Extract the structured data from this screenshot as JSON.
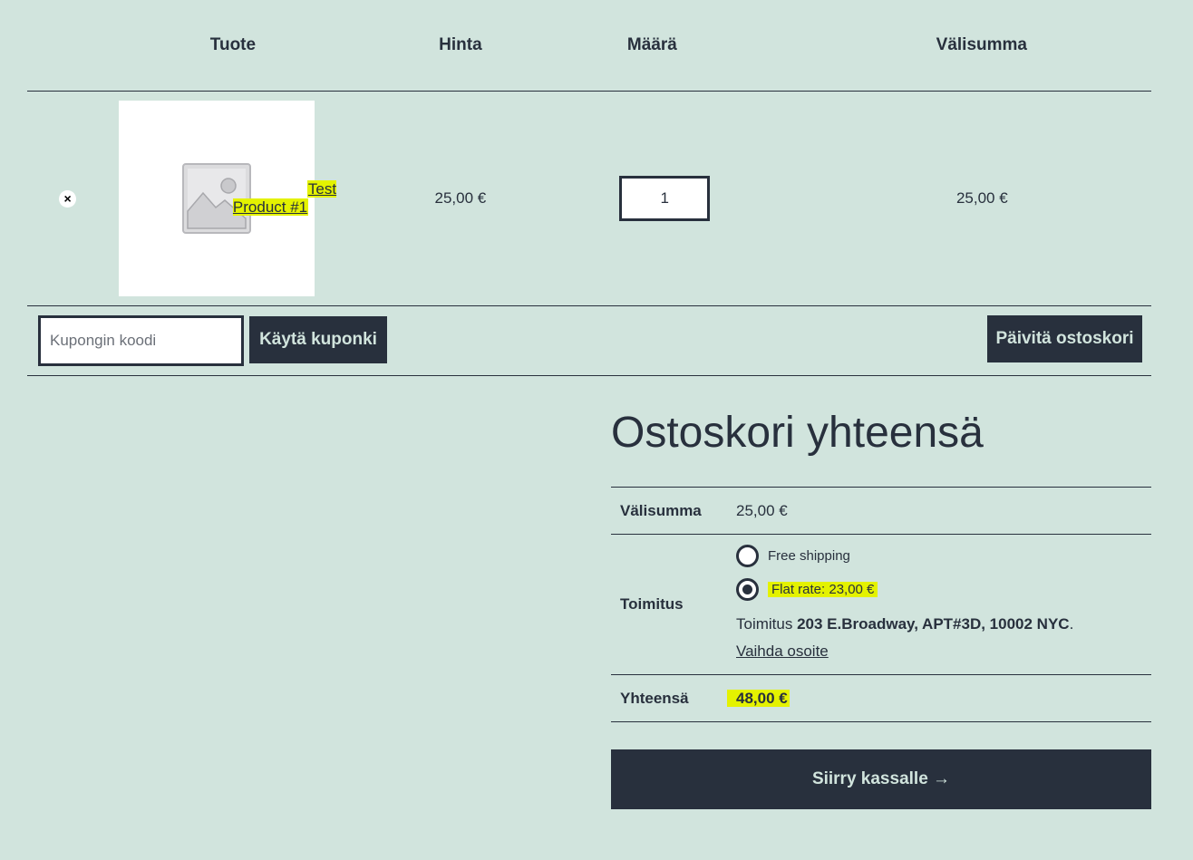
{
  "cart": {
    "headers": {
      "product": "Tuote",
      "price": "Hinta",
      "quantity": "Määrä",
      "subtotal": "Välisumma"
    },
    "items": [
      {
        "remove_symbol": "×",
        "thumbnail_icon": "image-placeholder-icon",
        "name": "Test Product #1",
        "price": "25,00 €",
        "quantity": "1",
        "subtotal": "25,00 €"
      }
    ],
    "coupon": {
      "placeholder": "Kupongin koodi",
      "value": "",
      "apply_label": "Käytä kuponki"
    },
    "update_label": "Päivitä ostoskori"
  },
  "totals": {
    "title": "Ostoskori yhteensä",
    "subtotal_label": "Välisumma",
    "subtotal_value": "25,00 €",
    "shipping_label": "Toimitus",
    "shipping_options": [
      {
        "label": "Free shipping",
        "selected": false
      },
      {
        "label": "Flat rate: 23,00 €",
        "selected": true
      }
    ],
    "destination_prefix": "Toimitus",
    "destination_address": "203 E.Broadway, APT#3D, 10002 NYC",
    "destination_suffix": ".",
    "change_address_label": "Vaihda osoite",
    "total_label": "Yhteensä",
    "total_value": "48,00 €",
    "checkout_label": "Siirry kassalle →"
  },
  "colors": {
    "background": "#d1e4dd",
    "text": "#28303d",
    "highlight": "#e4f200",
    "button_bg": "#28303d",
    "button_text": "#d1e4dd"
  }
}
